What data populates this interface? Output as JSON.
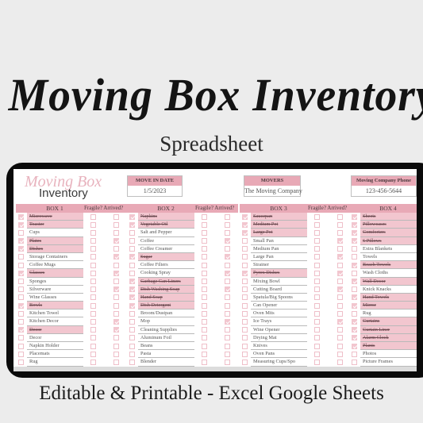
{
  "title": "Moving Box Inventory",
  "subtitle": "Spreadsheet",
  "footer": "Editable & Printable - Excel Google Sheets",
  "sheet": {
    "logo_script": "Moving Box",
    "logo_word": "Inventory",
    "info": [
      {
        "label": "MOVE IN DATE",
        "value": "1/5/2023"
      },
      {
        "label": "MOVERS",
        "value": "The Moving Company"
      },
      {
        "label": "Moving Company Phone",
        "value": "123-456-5644"
      }
    ],
    "col_fragile": "Fragile?",
    "col_arrived": "Arrived?",
    "colors": {
      "header_pink": "#e8a9b6",
      "row_pink": "#f2c6cf"
    },
    "boxes": [
      {
        "label": "BOX 1",
        "items": [
          {
            "name": "Microwave",
            "checked": true,
            "fragile": false,
            "arrived": false
          },
          {
            "name": "Toaster",
            "checked": true,
            "fragile": false,
            "arrived": false
          },
          {
            "name": "Cups",
            "checked": false,
            "fragile": false,
            "arrived": false
          },
          {
            "name": "Plates",
            "checked": true,
            "fragile": false,
            "arrived": true
          },
          {
            "name": "Dishes",
            "checked": true,
            "fragile": false,
            "arrived": false
          },
          {
            "name": "Storage Containers",
            "checked": false,
            "fragile": false,
            "arrived": true
          },
          {
            "name": "Coffee Mugs",
            "checked": false,
            "fragile": false,
            "arrived": false
          },
          {
            "name": "Glasses",
            "checked": true,
            "fragile": false,
            "arrived": true
          },
          {
            "name": "Sponges",
            "checked": false,
            "fragile": false,
            "arrived": false
          },
          {
            "name": "Silverware",
            "checked": false,
            "fragile": false,
            "arrived": true
          },
          {
            "name": "Wine Glasses",
            "checked": false,
            "fragile": false,
            "arrived": false
          },
          {
            "name": "Bowls",
            "checked": true,
            "fragile": false,
            "arrived": false
          },
          {
            "name": "Kitchen Towel",
            "checked": false,
            "fragile": false,
            "arrived": false
          },
          {
            "name": "Kitchen Decor",
            "checked": false,
            "fragile": false,
            "arrived": true
          },
          {
            "name": "Decor",
            "checked": true,
            "fragile": false,
            "arrived": true
          },
          {
            "name": "Decor",
            "checked": false,
            "fragile": false,
            "arrived": false
          },
          {
            "name": "Napkin Holder",
            "checked": false,
            "fragile": false,
            "arrived": false
          },
          {
            "name": "Placemats",
            "checked": false,
            "fragile": false,
            "arrived": false
          },
          {
            "name": "Rug",
            "checked": false,
            "fragile": false,
            "arrived": false
          }
        ]
      },
      {
        "label": "BOX 2",
        "items": [
          {
            "name": "Napkins",
            "checked": true,
            "fragile": false,
            "arrived": false
          },
          {
            "name": "Vegetable Oil",
            "checked": true,
            "fragile": false,
            "arrived": false
          },
          {
            "name": "Salt and Pepper",
            "checked": false,
            "fragile": false,
            "arrived": false
          },
          {
            "name": "Coffee",
            "checked": false,
            "fragile": false,
            "arrived": true
          },
          {
            "name": "Coffee Creamer",
            "checked": false,
            "fragile": false,
            "arrived": false
          },
          {
            "name": "Sugar",
            "checked": true,
            "fragile": false,
            "arrived": true
          },
          {
            "name": "Coffee Filters",
            "checked": false,
            "fragile": false,
            "arrived": false
          },
          {
            "name": "Cooking Spray",
            "checked": false,
            "fragile": false,
            "arrived": true
          },
          {
            "name": "Garbage Can Liners",
            "checked": true,
            "fragile": false,
            "arrived": false
          },
          {
            "name": "Dish Washing Soap",
            "checked": true,
            "fragile": false,
            "arrived": true
          },
          {
            "name": "Hand Soap",
            "checked": true,
            "fragile": false,
            "arrived": false
          },
          {
            "name": "Dish Detergent",
            "checked": true,
            "fragile": false,
            "arrived": false
          },
          {
            "name": "Broom/Dustpan",
            "checked": false,
            "fragile": false,
            "arrived": false
          },
          {
            "name": "Mop",
            "checked": false,
            "fragile": false,
            "arrived": true
          },
          {
            "name": "Cleaning Supplies",
            "checked": false,
            "fragile": false,
            "arrived": false
          },
          {
            "name": "Aluminum Foil",
            "checked": false,
            "fragile": false,
            "arrived": false
          },
          {
            "name": "Beans",
            "checked": false,
            "fragile": false,
            "arrived": false
          },
          {
            "name": "Pasta",
            "checked": false,
            "fragile": false,
            "arrived": false
          },
          {
            "name": "Blender",
            "checked": false,
            "fragile": false,
            "arrived": false
          }
        ]
      },
      {
        "label": "BOX 3",
        "items": [
          {
            "name": "Saucepan",
            "checked": true,
            "fragile": false,
            "arrived": false
          },
          {
            "name": "Medium Pot",
            "checked": true,
            "fragile": false,
            "arrived": false
          },
          {
            "name": "Large Pot",
            "checked": true,
            "fragile": false,
            "arrived": false
          },
          {
            "name": "Small Pan",
            "checked": false,
            "fragile": false,
            "arrived": true
          },
          {
            "name": "Medium Pan",
            "checked": false,
            "fragile": false,
            "arrived": false
          },
          {
            "name": "Large Pan",
            "checked": false,
            "fragile": false,
            "arrived": true
          },
          {
            "name": "Strainer",
            "checked": false,
            "fragile": false,
            "arrived": false
          },
          {
            "name": "Pyrex Dishes",
            "checked": true,
            "fragile": false,
            "arrived": true
          },
          {
            "name": "Mixing Bowl",
            "checked": false,
            "fragile": false,
            "arrived": false
          },
          {
            "name": "Cutting Board",
            "checked": false,
            "fragile": false,
            "arrived": true
          },
          {
            "name": "Spatula/Big Spoons",
            "checked": false,
            "fragile": false,
            "arrived": false
          },
          {
            "name": "Can Opener",
            "checked": false,
            "fragile": false,
            "arrived": false
          },
          {
            "name": "Oven Mits",
            "checked": false,
            "fragile": false,
            "arrived": false
          },
          {
            "name": "Ice Trays",
            "checked": false,
            "fragile": false,
            "arrived": true
          },
          {
            "name": "Wine Opener",
            "checked": false,
            "fragile": false,
            "arrived": false
          },
          {
            "name": "Drying Mat",
            "checked": false,
            "fragile": false,
            "arrived": false
          },
          {
            "name": "Knives",
            "checked": false,
            "fragile": false,
            "arrived": false
          },
          {
            "name": "Oven Pans",
            "checked": false,
            "fragile": false,
            "arrived": false
          },
          {
            "name": "Measuring Cups/Spo",
            "checked": false,
            "fragile": false,
            "arrived": false
          }
        ]
      },
      {
        "label": "BOX 4",
        "items": [
          {
            "name": "Sheets",
            "checked": true,
            "fragile": false,
            "arrived": false
          },
          {
            "name": "Pillowcases",
            "checked": true,
            "fragile": false,
            "arrived": false
          },
          {
            "name": "Comforters",
            "checked": true,
            "fragile": false,
            "arrived": false
          },
          {
            "name": "6 Pillows",
            "checked": true,
            "fragile": false,
            "arrived": false
          },
          {
            "name": "Extra Blankets",
            "checked": false,
            "fragile": false,
            "arrived": false
          },
          {
            "name": "Towels",
            "checked": false,
            "fragile": false,
            "arrived": false
          },
          {
            "name": "Beach Towels",
            "checked": true,
            "fragile": false,
            "arrived": false
          },
          {
            "name": "Wash Cloths",
            "checked": false,
            "fragile": false,
            "arrived": false
          },
          {
            "name": "Wall Decor",
            "checked": true,
            "fragile": false,
            "arrived": false
          },
          {
            "name": "Knick Knacks",
            "checked": false,
            "fragile": false,
            "arrived": false
          },
          {
            "name": "Hand Towels",
            "checked": true,
            "fragile": false,
            "arrived": false
          },
          {
            "name": "Mirror",
            "checked": true,
            "fragile": false,
            "arrived": false
          },
          {
            "name": "Rug",
            "checked": false,
            "fragile": false,
            "arrived": false
          },
          {
            "name": "Curtains",
            "checked": true,
            "fragile": false,
            "arrived": false
          },
          {
            "name": "Curtain Liner",
            "checked": true,
            "fragile": false,
            "arrived": false
          },
          {
            "name": "Alarm Clock",
            "checked": true,
            "fragile": false,
            "arrived": false
          },
          {
            "name": "Plants",
            "checked": true,
            "fragile": false,
            "arrived": false
          },
          {
            "name": "Photos",
            "checked": false,
            "fragile": false,
            "arrived": false
          },
          {
            "name": "Picture Frames",
            "checked": false,
            "fragile": false,
            "arrived": false
          }
        ]
      }
    ]
  }
}
